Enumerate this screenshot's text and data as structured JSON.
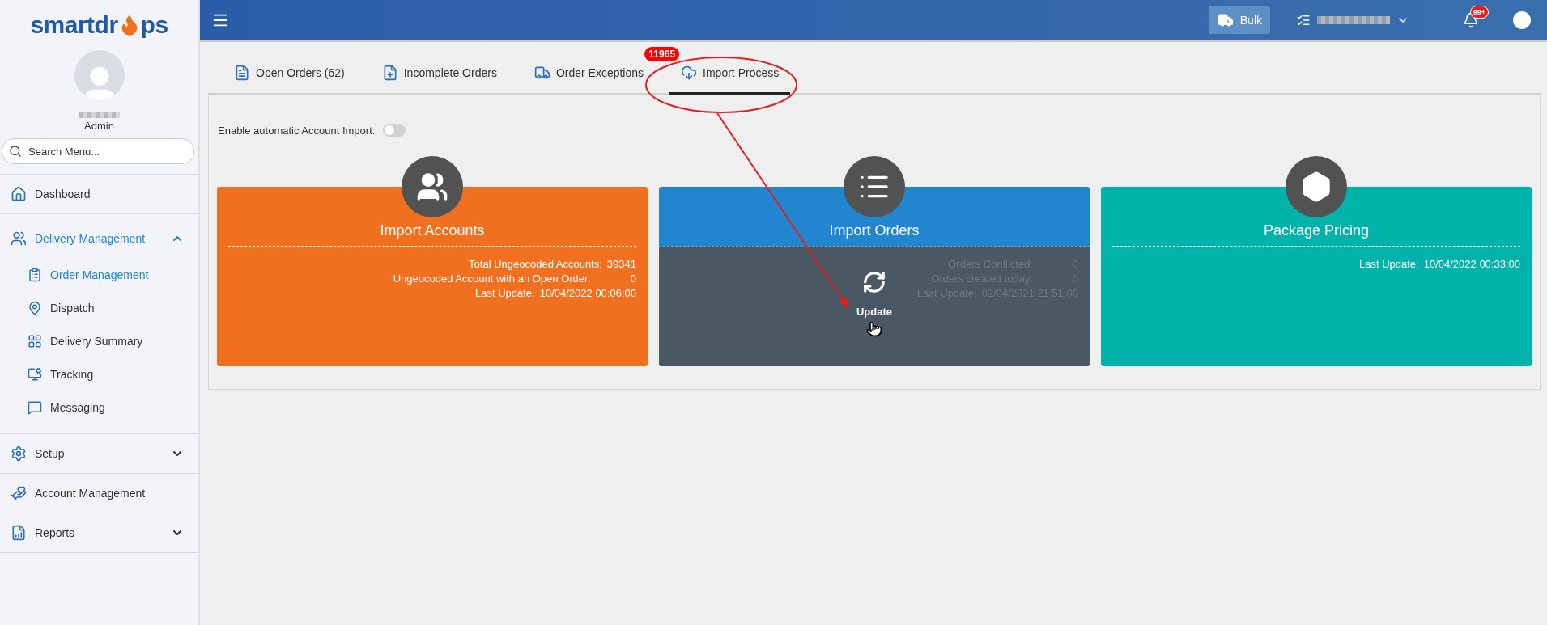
{
  "sidebar": {
    "logo": {
      "before": "smartdr",
      "after": "ps"
    },
    "user": {
      "role": "Admin"
    },
    "search": {
      "placeholder": "Search Menu..."
    },
    "items": [
      {
        "label": "Dashboard",
        "selected": false,
        "expanded": false
      },
      {
        "label": "Delivery Management",
        "selected": true,
        "expanded": true,
        "children": [
          {
            "label": "Order Management",
            "selected": true
          },
          {
            "label": "Dispatch",
            "selected": false
          },
          {
            "label": "Delivery Summary",
            "selected": false
          },
          {
            "label": "Tracking",
            "selected": false
          },
          {
            "label": "Messaging",
            "selected": false
          }
        ]
      },
      {
        "label": "Setup",
        "selected": false,
        "expanded": false,
        "has_submenu": true
      },
      {
        "label": "Account Management",
        "selected": false,
        "expanded": false
      },
      {
        "label": "Reports",
        "selected": false,
        "expanded": false,
        "has_submenu": true
      }
    ]
  },
  "top_bar": {
    "bulk_button": "Bulk",
    "notifications_badge": "99+"
  },
  "tabs": [
    {
      "label": "Open Orders (62)",
      "selected": false
    },
    {
      "label": "Incomplete Orders",
      "selected": false
    },
    {
      "label": "Order Exceptions",
      "selected": false,
      "badge": "11965"
    },
    {
      "label": "Import Process",
      "selected": true
    }
  ],
  "auto_import": {
    "label": "Enable automatic Account Import:",
    "on": false
  },
  "cards": [
    {
      "title": "Import Accounts",
      "color": "#f07020",
      "stats": [
        {
          "label": "Total Ungeocoded Accounts:",
          "value": "39341"
        },
        {
          "label": "Ungeocoded Account with an Open Order:",
          "value": "0"
        },
        {
          "label": "Last Update:",
          "value": "10/04/2022 00:06:00"
        }
      ]
    },
    {
      "title": "Import Orders",
      "color": "#2185d0",
      "hovered": true,
      "action": "Update",
      "stats": [
        {
          "label": "Orders Conflicted:",
          "value": "0"
        },
        {
          "label": "Orders created today:",
          "value": "0"
        },
        {
          "label": "Last Update:",
          "value": "02/04/2021 21:51:00"
        }
      ]
    },
    {
      "title": "Package Pricing",
      "color": "#00b3aa",
      "stats": [
        {
          "label": "Last Update:",
          "value": "10/04/2022 00:33:00"
        }
      ]
    }
  ]
}
